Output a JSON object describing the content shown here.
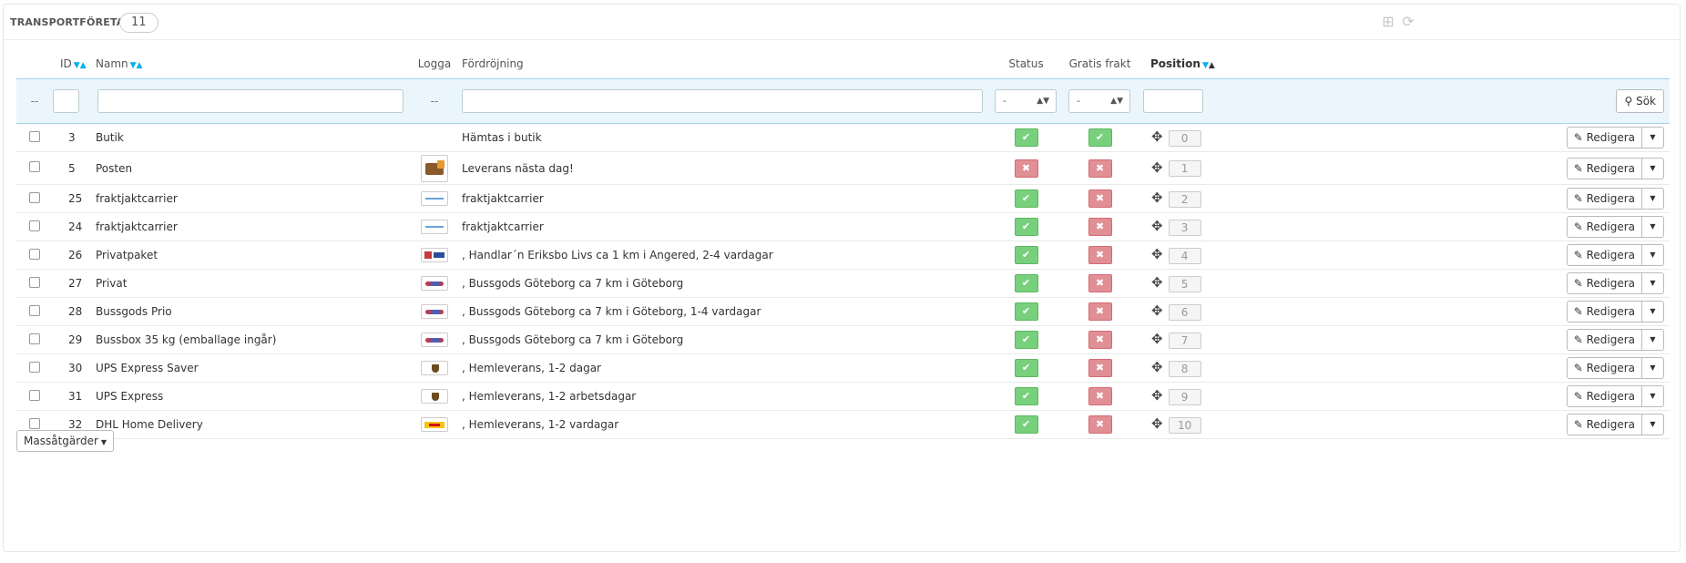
{
  "panel": {
    "title": "Transportföretag",
    "count": "11",
    "add_icon": "plus-square-icon",
    "refresh_icon": "refresh-icon"
  },
  "columns": {
    "id": "ID",
    "name": "Namn",
    "logo": "Logga",
    "delay": "Fördröjning",
    "status": "Status",
    "free": "Gratis frakt",
    "position": "Position"
  },
  "filters": {
    "dash": "--",
    "status_selected": "-",
    "free_selected": "-",
    "search_label": "Sök"
  },
  "rows": [
    {
      "id": "3",
      "name": "Butik",
      "logo": "none",
      "delay": "Hämtas i butik",
      "status": "ok",
      "free": "ok",
      "position": "0"
    },
    {
      "id": "5",
      "name": "Posten",
      "logo": "van",
      "delay": "Leverans nästa dag!",
      "status": "no",
      "free": "no",
      "position": "1"
    },
    {
      "id": "25",
      "name": "fraktjaktcarrier",
      "logo": "fraktjakt",
      "delay": "fraktjaktcarrier",
      "status": "ok",
      "free": "no",
      "position": "2"
    },
    {
      "id": "24",
      "name": "fraktjaktcarrier",
      "logo": "fraktjakt",
      "delay": "fraktjaktcarrier",
      "status": "ok",
      "free": "no",
      "position": "3"
    },
    {
      "id": "26",
      "name": "Privatpaket",
      "logo": "privatpaket",
      "delay": ", Handlar´n Eriksbo Livs ca 1 km i Angered, 2-4 vardagar",
      "status": "ok",
      "free": "no",
      "position": "4"
    },
    {
      "id": "27",
      "name": "Privat",
      "logo": "bussgods",
      "delay": ", Bussgods Göteborg ca 7 km i Göteborg",
      "status": "ok",
      "free": "no",
      "position": "5"
    },
    {
      "id": "28",
      "name": "Bussgods Prio",
      "logo": "bussgods",
      "delay": ", Bussgods Göteborg ca 7 km i Göteborg, 1-4 vardagar",
      "status": "ok",
      "free": "no",
      "position": "6"
    },
    {
      "id": "29",
      "name": "Bussbox 35 kg (emballage ingår)",
      "logo": "bussgods",
      "delay": ", Bussgods Göteborg ca 7 km i Göteborg",
      "status": "ok",
      "free": "no",
      "position": "7"
    },
    {
      "id": "30",
      "name": "UPS Express Saver",
      "logo": "ups",
      "delay": ", Hemleverans, 1-2 dagar",
      "status": "ok",
      "free": "no",
      "position": "8"
    },
    {
      "id": "31",
      "name": "UPS Express",
      "logo": "ups",
      "delay": ", Hemleverans, 1-2 arbetsdagar",
      "status": "ok",
      "free": "no",
      "position": "9"
    },
    {
      "id": "32",
      "name": "DHL Home Delivery",
      "logo": "dhl",
      "delay": ", Hemleverans, 1-2 vardagar",
      "status": "ok",
      "free": "no",
      "position": "10"
    }
  ],
  "row_actions": {
    "edit_label": "Redigera"
  },
  "bulk": {
    "label": "Massåtgärder"
  },
  "colors": {
    "enabled": "#78d07d",
    "disabled": "#e08f95",
    "sort_arrow": "#00aff0",
    "filter_bg": "#eaf6fb"
  }
}
